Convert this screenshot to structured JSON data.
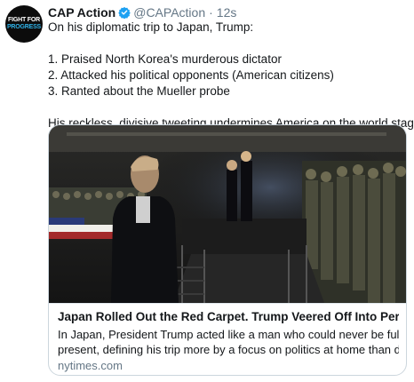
{
  "tweet": {
    "avatar_line1": "FIGHT FOR",
    "avatar_line2": "PROGRESS",
    "name": "CAP Action",
    "handle": "@CAPAction",
    "separator": "·",
    "time": "12s",
    "lines": [
      "On his diplomatic trip to Japan, Trump:",
      "1. Praised North Korea's murderous dictator",
      "2. Attacked his political opponents (American citizens)",
      "3. Ranted about the Mueller probe",
      "His reckless, divisive tweeting undermines America on the world stage."
    ]
  },
  "card": {
    "title": "Japan Rolled Out the Red Carpet. Trump Veered Off Into Personal Fix...",
    "description_line1": "In Japan, President Trump acted like a man who could never be fully",
    "description_line2": "present, defining his trip more by a focus on politics at home than diplom...",
    "domain": "nytimes.com"
  },
  "colors": {
    "text": "#14171a",
    "secondary": "#657786",
    "verified": "#1da1f2",
    "border": "#ccd6dd"
  },
  "icons": {
    "verified": "verified-badge-icon"
  }
}
